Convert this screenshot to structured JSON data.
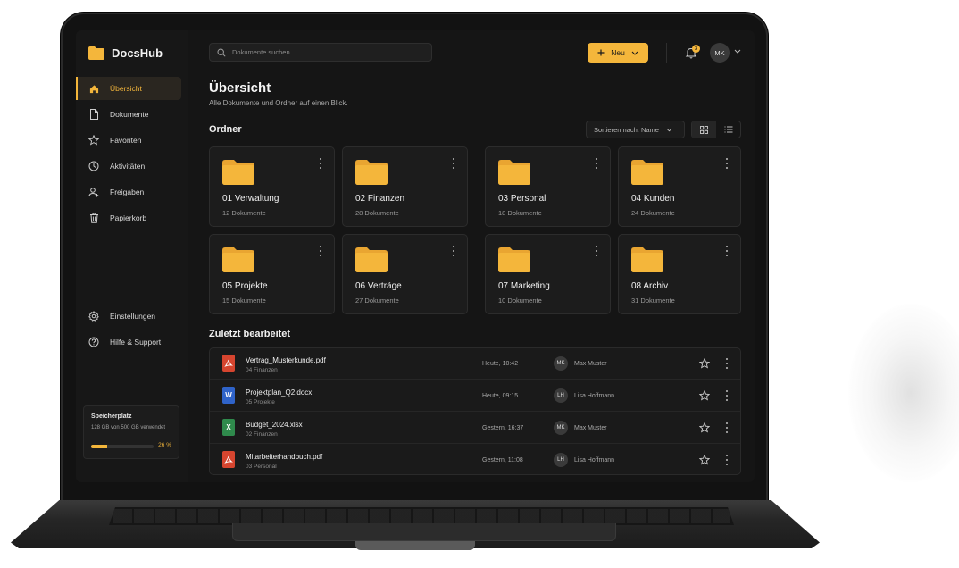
{
  "app": {
    "name": "DocsHub"
  },
  "colors": {
    "accent": "#f4b63b",
    "background": "#151515",
    "sidebar": "#171717",
    "card": "#1c1c1c",
    "pdf": "#d6452f",
    "word": "#2f63c9",
    "excel": "#2f8a4c"
  },
  "sidebar": {
    "items": [
      {
        "label": "Übersicht",
        "icon": "home-icon",
        "active": true
      },
      {
        "label": "Dokumente",
        "icon": "document-icon"
      },
      {
        "label": "Favoriten",
        "icon": "star-icon"
      },
      {
        "label": "Aktivitäten",
        "icon": "clock-icon"
      },
      {
        "label": "Freigaben",
        "icon": "user-share-icon"
      },
      {
        "label": "Papierkorb",
        "icon": "trash-icon"
      }
    ],
    "bottom_items": [
      {
        "label": "Einstellungen",
        "icon": "gear-icon"
      },
      {
        "label": "Hilfe & Support",
        "icon": "help-icon"
      }
    ],
    "storage": {
      "title": "Speicherplatz",
      "usage": "128 GB von 500 GB verwendet",
      "percent_label": "26 %",
      "percent": 26
    }
  },
  "header": {
    "search_placeholder": "Dokumente suchen...",
    "new_label": "Neu",
    "notifications": "3",
    "user_initials": "MK"
  },
  "main": {
    "title": "Übersicht",
    "subtitle": "Alle Dokumente und Ordner auf einen Blick.",
    "folders_heading": "Ordner",
    "sort_label": "Sortieren nach: Name",
    "folders": [
      {
        "name": "01 Verwaltung",
        "count": "12 Dokumente"
      },
      {
        "name": "02 Finanzen",
        "count": "28 Dokumente"
      },
      {
        "name": "03 Personal",
        "count": "18 Dokumente"
      },
      {
        "name": "04 Kunden",
        "count": "24 Dokumente"
      },
      {
        "name": "05 Projekte",
        "count": "15 Dokumente"
      },
      {
        "name": "06 Verträge",
        "count": "27 Dokumente"
      },
      {
        "name": "07 Marketing",
        "count": "10 Dokumente"
      },
      {
        "name": "08 Archiv",
        "count": "31 Dokumente"
      }
    ],
    "recent_heading": "Zuletzt bearbeitet",
    "recent": [
      {
        "name": "Vertrag_Musterkunde.pdf",
        "folder": "04 Finanzen",
        "time": "Heute, 10:42",
        "initials": "MK",
        "user": "Max Muster",
        "type": "pdf"
      },
      {
        "name": "Projektplan_Q2.docx",
        "folder": "05 Projekte",
        "time": "Heute, 09:15",
        "initials": "LH",
        "user": "Lisa Hoffmann",
        "type": "word"
      },
      {
        "name": "Budget_2024.xlsx",
        "folder": "02 Finanzen",
        "time": "Gestern, 16:37",
        "initials": "MK",
        "user": "Max Muster",
        "type": "excel"
      },
      {
        "name": "Mitarbeiterhandbuch.pdf",
        "folder": "03 Personal",
        "time": "Gestern, 11:08",
        "initials": "LH",
        "user": "Lisa Hoffmann",
        "type": "pdf"
      }
    ]
  }
}
